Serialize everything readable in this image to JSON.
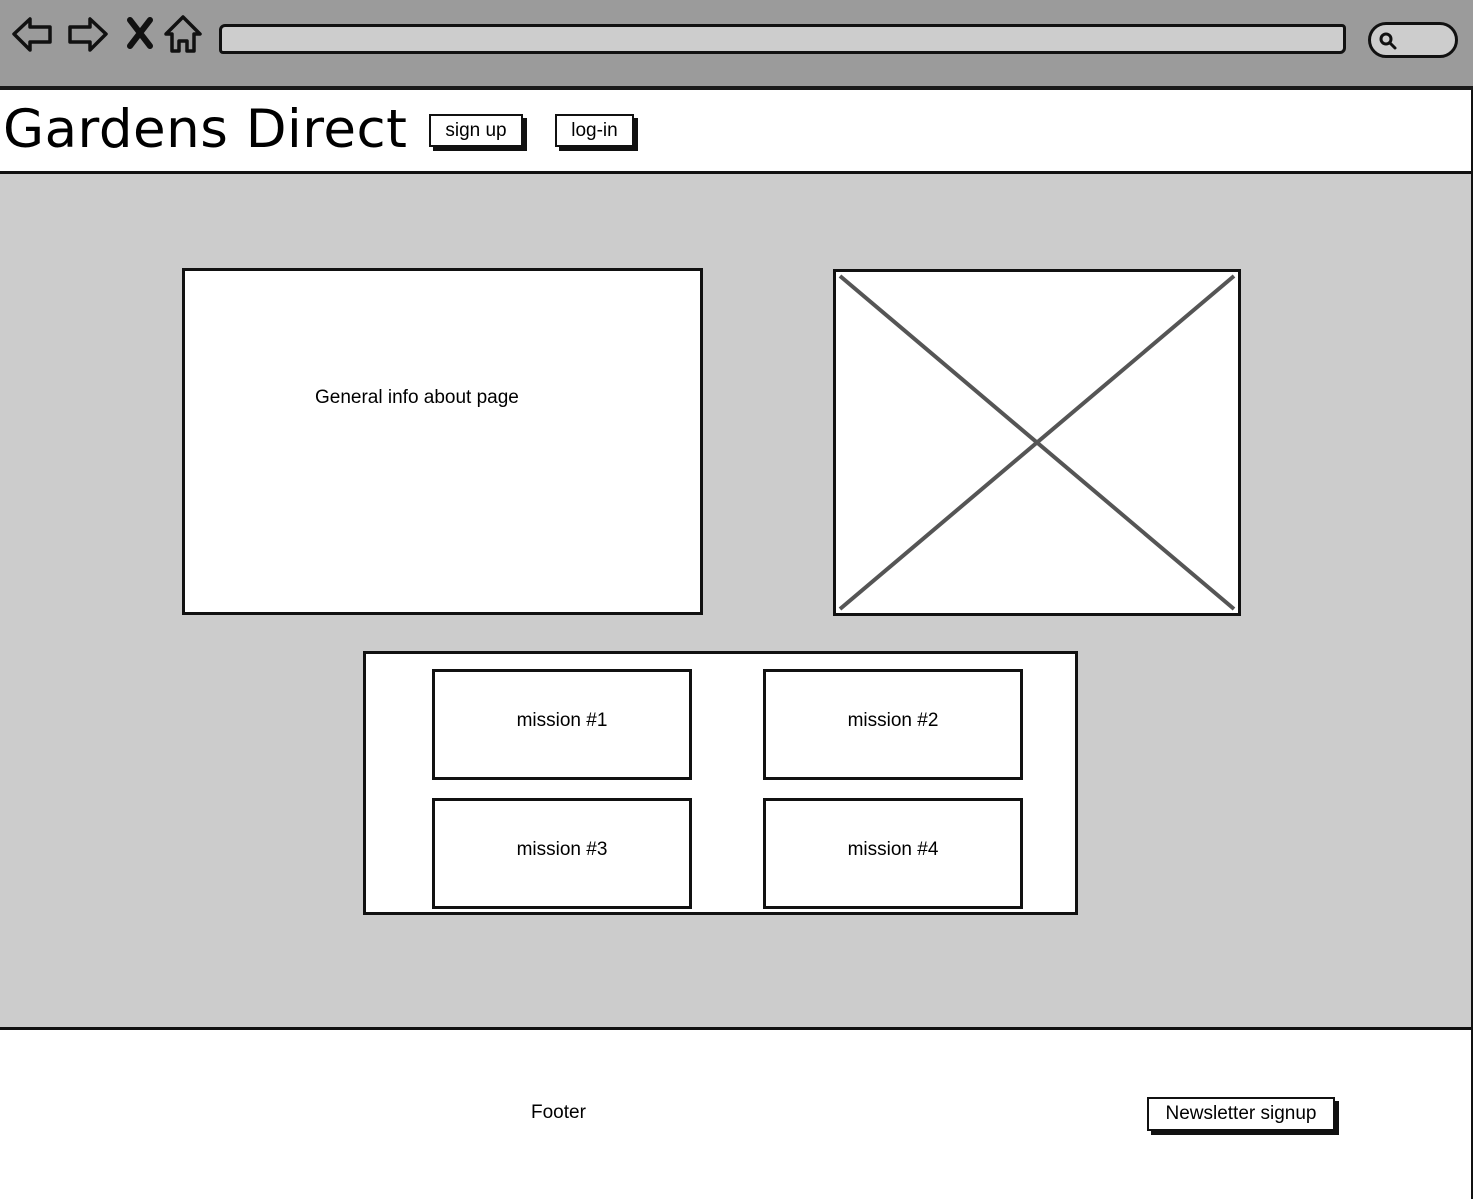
{
  "browser": {
    "icons": [
      "back-arrow-icon",
      "forward-arrow-icon",
      "stop-icon",
      "home-icon",
      "search-icon"
    ],
    "address": ""
  },
  "header": {
    "title": "Gardens Direct",
    "signup_label": "sign up",
    "login_label": "log-in"
  },
  "main": {
    "info_text": "General info about page",
    "missions": [
      "mission #1",
      "mission #2",
      "mission #3",
      "mission #4"
    ]
  },
  "footer": {
    "label": "Footer",
    "newsletter_label": "Newsletter signup"
  },
  "colors": {
    "chrome": "#9b9b9b",
    "content_bg": "#cccccc",
    "ink": "#111111"
  }
}
